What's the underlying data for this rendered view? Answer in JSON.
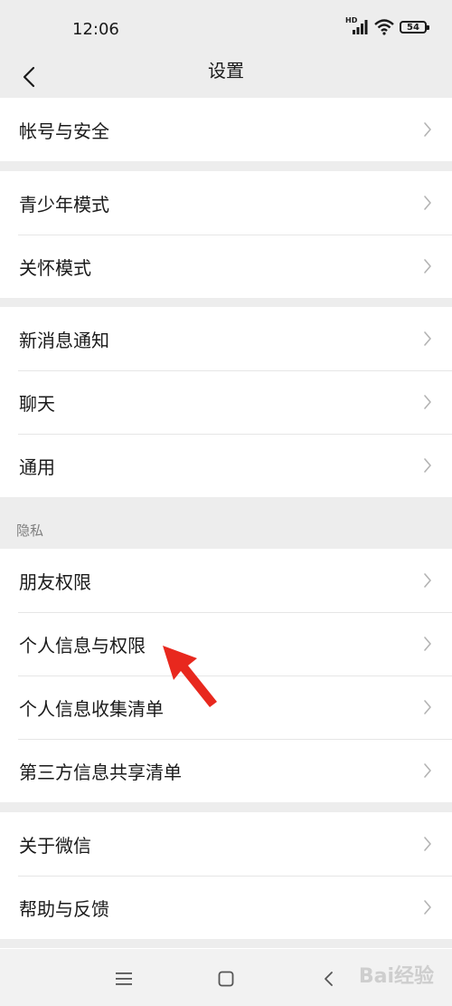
{
  "status": {
    "time": "12:06",
    "network_label": "HD",
    "battery": "54"
  },
  "nav": {
    "title": "设置"
  },
  "groups": [
    {
      "items": [
        {
          "label": "帐号与安全"
        }
      ]
    },
    {
      "items": [
        {
          "label": "青少年模式"
        },
        {
          "label": "关怀模式"
        }
      ]
    },
    {
      "items": [
        {
          "label": "新消息通知"
        },
        {
          "label": "聊天"
        },
        {
          "label": "通用"
        }
      ]
    },
    {
      "header": "隐私",
      "items": [
        {
          "label": "朋友权限"
        },
        {
          "label": "个人信息与权限"
        },
        {
          "label": "个人信息收集清单"
        },
        {
          "label": "第三方信息共享清单"
        }
      ]
    },
    {
      "items": [
        {
          "label": "关于微信"
        },
        {
          "label": "帮助与反馈"
        }
      ]
    }
  ],
  "watermark": "Bai经验",
  "colors": {
    "background": "#ededed",
    "annotation": "#e8281e"
  },
  "icons": {
    "back": "chevron-left-icon",
    "row": "chevron-right-icon",
    "menu": "menu-icon",
    "home": "home-icon",
    "back_sys": "back-icon"
  }
}
